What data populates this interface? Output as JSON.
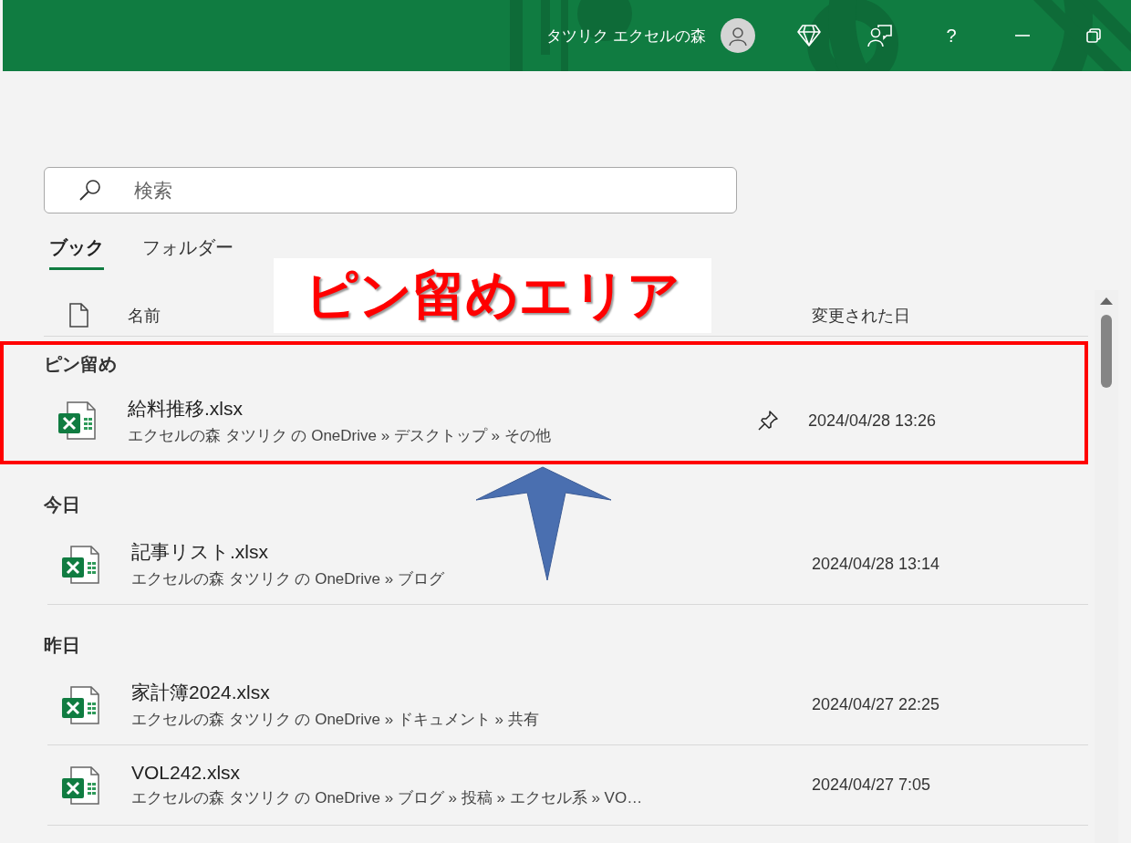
{
  "header": {
    "user_name": "タツリク エクセルの森",
    "help_label": "?"
  },
  "search": {
    "placeholder": "検索"
  },
  "tabs": [
    {
      "label": "ブック",
      "selected": true
    },
    {
      "label": "フォルダー",
      "selected": false
    }
  ],
  "columns": {
    "name": "名前",
    "modified": "変更された日"
  },
  "annotation": {
    "text": "ピン留めエリア"
  },
  "sections": [
    {
      "title": "ピン留め",
      "highlighted": true,
      "files": [
        {
          "name": "給料推移.xlsx",
          "path": "エクセルの森 タツリク の OneDrive » デスクトップ » その他",
          "modified": "2024/04/28 13:26",
          "pinned": true
        }
      ]
    },
    {
      "title": "今日",
      "highlighted": false,
      "files": [
        {
          "name": "記事リスト.xlsx",
          "path": "エクセルの森 タツリク の OneDrive » ブログ",
          "modified": "2024/04/28 13:14",
          "pinned": false
        }
      ]
    },
    {
      "title": "昨日",
      "highlighted": false,
      "files": [
        {
          "name": "家計簿2024.xlsx",
          "path": "エクセルの森 タツリク の OneDrive » ドキュメント » 共有",
          "modified": "2024/04/27 22:25",
          "pinned": false
        },
        {
          "name": "VOL242.xlsx",
          "path": "エクセルの森 タツリク の OneDrive » ブログ » 投稿 » エクセル系 » VO…",
          "modified": "2024/04/27 7:05",
          "pinned": false
        }
      ]
    }
  ]
}
